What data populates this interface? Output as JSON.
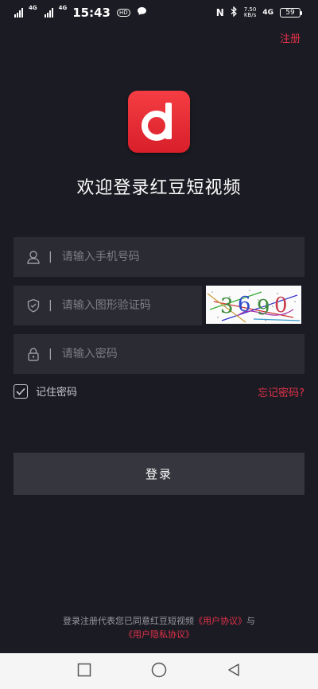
{
  "status_bar": {
    "net1": "4G",
    "net2": "4G",
    "time": "15:43",
    "hd": "HD",
    "speed_value": "7.50",
    "speed_unit": "KB/s",
    "net_right": "4G",
    "battery": "59"
  },
  "header": {
    "register_label": "注册"
  },
  "welcome_title": "欢迎登录红豆短视频",
  "form": {
    "phone": {
      "placeholder": "请输入手机号码",
      "value": "",
      "icon": "user-icon"
    },
    "captcha": {
      "placeholder": "请输入图形验证码",
      "value": "",
      "icon": "shield-check-icon",
      "image_text": "3690"
    },
    "password": {
      "placeholder": "请输入密码",
      "value": "",
      "icon": "lock-icon"
    },
    "separator": "|"
  },
  "remember": {
    "label": "记住密码",
    "checked": true
  },
  "forgot_label": "忘记密码?",
  "login_label": "登录",
  "agreement": {
    "prefix": "登录注册代表您已同意红豆短视频",
    "user_agreement": "《用户协议》",
    "and": "与",
    "privacy": "《用户隐私协议》"
  },
  "nav": {
    "recents": "square-icon",
    "home": "circle-icon",
    "back": "triangle-back-icon"
  },
  "colors": {
    "background": "#1b1b23",
    "accent": "#e4324a",
    "field": "#2b2b34",
    "button": "#36363e"
  }
}
